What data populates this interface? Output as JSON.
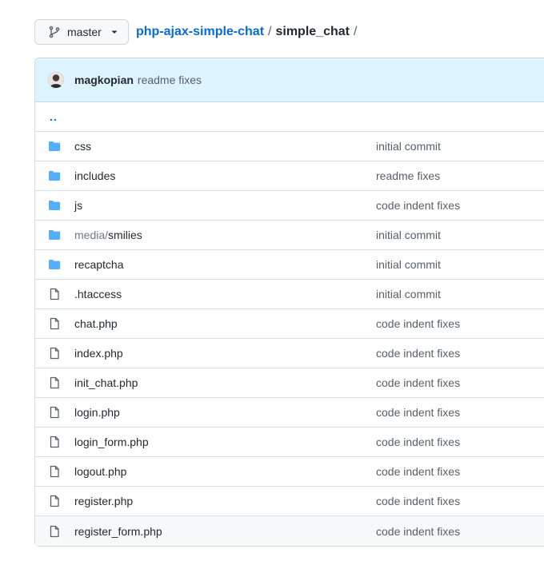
{
  "branch": {
    "label": "master"
  },
  "breadcrumb": {
    "repo": "php-ajax-simple-chat",
    "sep1": "/",
    "folder": "simple_chat",
    "sep2": "/"
  },
  "latest_commit": {
    "author": "magkopian",
    "message": "readme fixes"
  },
  "parent_dir": "..",
  "files": [
    {
      "type": "dir",
      "prefix": "",
      "name": "css",
      "message": "initial commit"
    },
    {
      "type": "dir",
      "prefix": "",
      "name": "includes",
      "message": "readme fixes"
    },
    {
      "type": "dir",
      "prefix": "",
      "name": "js",
      "message": "code indent fixes"
    },
    {
      "type": "dir",
      "prefix": "media/",
      "name": "smilies",
      "message": "initial commit"
    },
    {
      "type": "dir",
      "prefix": "",
      "name": "recaptcha",
      "message": "initial commit"
    },
    {
      "type": "file",
      "prefix": "",
      "name": ".htaccess",
      "message": "initial commit"
    },
    {
      "type": "file",
      "prefix": "",
      "name": "chat.php",
      "message": "code indent fixes"
    },
    {
      "type": "file",
      "prefix": "",
      "name": "index.php",
      "message": "code indent fixes"
    },
    {
      "type": "file",
      "prefix": "",
      "name": "init_chat.php",
      "message": "code indent fixes"
    },
    {
      "type": "file",
      "prefix": "",
      "name": "login.php",
      "message": "code indent fixes"
    },
    {
      "type": "file",
      "prefix": "",
      "name": "login_form.php",
      "message": "code indent fixes"
    },
    {
      "type": "file",
      "prefix": "",
      "name": "logout.php",
      "message": "code indent fixes"
    },
    {
      "type": "file",
      "prefix": "",
      "name": "register.php",
      "message": "code indent fixes"
    },
    {
      "type": "file",
      "prefix": "",
      "name": "register_form.php",
      "message": "code indent fixes"
    }
  ],
  "colors": {
    "folder": "#54aeff",
    "file": "#57606a",
    "link": "#0969da",
    "commit_header_bg": "#ddf4ff"
  }
}
